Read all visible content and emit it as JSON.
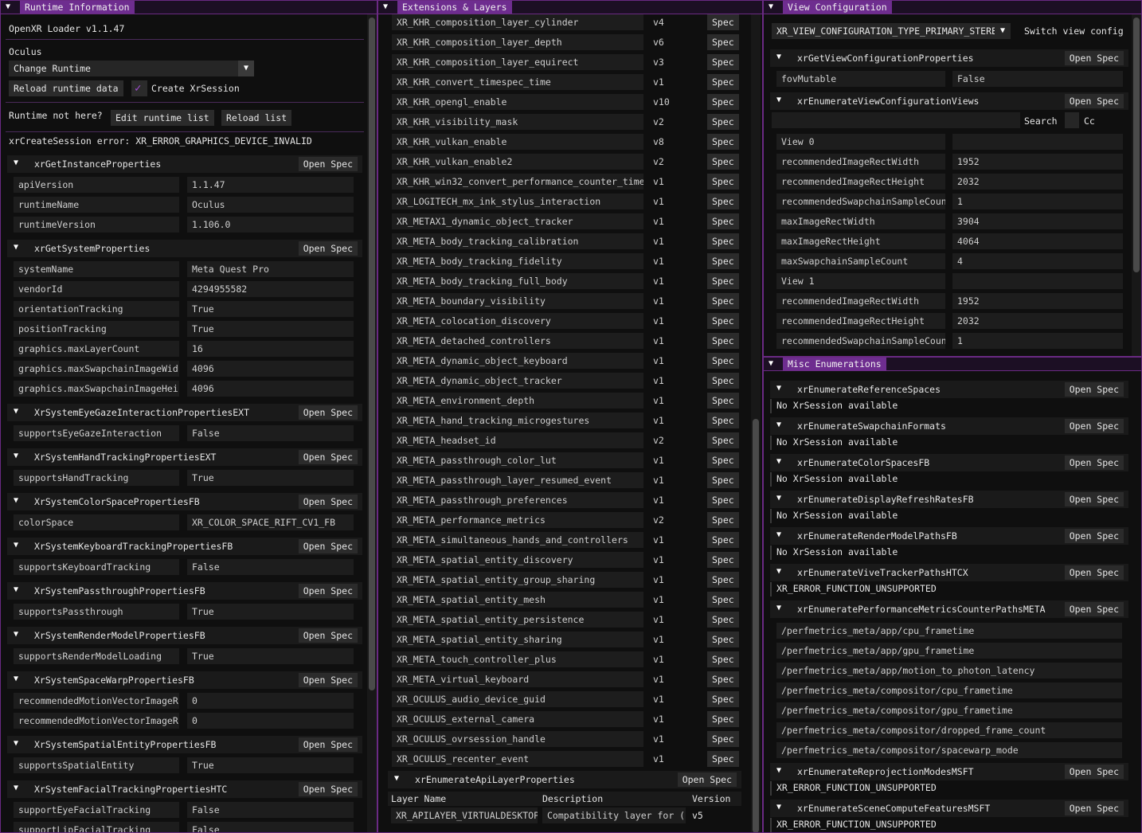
{
  "runtime": {
    "title": "Runtime Information",
    "loader": "OpenXR Loader v1.1.47",
    "runtime_name": "Oculus",
    "change_runtime": "Change Runtime",
    "reload_runtime": "Reload runtime data",
    "create_session": "Create XrSession",
    "not_here": "Runtime not here?",
    "edit_list": "Edit runtime list",
    "reload_list": "Reload list",
    "error": "xrCreateSession error: XR_ERROR_GRAPHICS_DEVICE_INVALID",
    "open_spec": "Open Spec",
    "sections": [
      {
        "name": "xrGetInstanceProperties",
        "rows": [
          [
            "apiVersion",
            "1.1.47"
          ],
          [
            "runtimeName",
            "Oculus"
          ],
          [
            "runtimeVersion",
            "1.106.0"
          ]
        ]
      },
      {
        "name": "xrGetSystemProperties",
        "rows": [
          [
            "systemName",
            "Meta Quest Pro"
          ],
          [
            "vendorId",
            "4294955582"
          ],
          [
            "orientationTracking",
            "True"
          ],
          [
            "positionTracking",
            "True"
          ],
          [
            "graphics.maxLayerCount",
            "16"
          ],
          [
            "graphics.maxSwapchainImageWid",
            "4096"
          ],
          [
            "graphics.maxSwapchainImageHei",
            "4096"
          ]
        ]
      },
      {
        "name": "XrSystemEyeGazeInteractionPropertiesEXT",
        "rows": [
          [
            "supportsEyeGazeInteraction",
            "False"
          ]
        ]
      },
      {
        "name": "XrSystemHandTrackingPropertiesEXT",
        "rows": [
          [
            "supportsHandTracking",
            "True"
          ]
        ]
      },
      {
        "name": "XrSystemColorSpacePropertiesFB",
        "rows": [
          [
            "colorSpace",
            "XR_COLOR_SPACE_RIFT_CV1_FB"
          ]
        ]
      },
      {
        "name": "XrSystemKeyboardTrackingPropertiesFB",
        "rows": [
          [
            "supportsKeyboardTracking",
            "False"
          ]
        ]
      },
      {
        "name": "XrSystemPassthroughPropertiesFB",
        "rows": [
          [
            "supportsPassthrough",
            "True"
          ]
        ]
      },
      {
        "name": "XrSystemRenderModelPropertiesFB",
        "rows": [
          [
            "supportsRenderModelLoading",
            "True"
          ]
        ]
      },
      {
        "name": "XrSystemSpaceWarpPropertiesFB",
        "rows": [
          [
            "recommendedMotionVectorImageR",
            "0"
          ],
          [
            "recommendedMotionVectorImageR",
            "0"
          ]
        ]
      },
      {
        "name": "XrSystemSpatialEntityPropertiesFB",
        "rows": [
          [
            "supportsSpatialEntity",
            "True"
          ]
        ]
      },
      {
        "name": "XrSystemFacialTrackingPropertiesHTC",
        "rows": [
          [
            "supportEyeFacialTracking",
            "False"
          ],
          [
            "supportLipFacialTracking",
            "False"
          ]
        ]
      }
    ]
  },
  "extensions": {
    "title": "Extensions & Layers",
    "spec": "Spec",
    "items": [
      [
        "XR_KHR_composition_layer_cylinder",
        "v4"
      ],
      [
        "XR_KHR_composition_layer_depth",
        "v6"
      ],
      [
        "XR_KHR_composition_layer_equirect",
        "v3"
      ],
      [
        "XR_KHR_convert_timespec_time",
        "v1"
      ],
      [
        "XR_KHR_opengl_enable",
        "v10"
      ],
      [
        "XR_KHR_visibility_mask",
        "v2"
      ],
      [
        "XR_KHR_vulkan_enable",
        "v8"
      ],
      [
        "XR_KHR_vulkan_enable2",
        "v2"
      ],
      [
        "XR_KHR_win32_convert_performance_counter_time",
        "v1"
      ],
      [
        "XR_LOGITECH_mx_ink_stylus_interaction",
        "v1"
      ],
      [
        "XR_METAX1_dynamic_object_tracker",
        "v1"
      ],
      [
        "XR_META_body_tracking_calibration",
        "v1"
      ],
      [
        "XR_META_body_tracking_fidelity",
        "v1"
      ],
      [
        "XR_META_body_tracking_full_body",
        "v1"
      ],
      [
        "XR_META_boundary_visibility",
        "v1"
      ],
      [
        "XR_META_colocation_discovery",
        "v1"
      ],
      [
        "XR_META_detached_controllers",
        "v1"
      ],
      [
        "XR_META_dynamic_object_keyboard",
        "v1"
      ],
      [
        "XR_META_dynamic_object_tracker",
        "v1"
      ],
      [
        "XR_META_environment_depth",
        "v1"
      ],
      [
        "XR_META_hand_tracking_microgestures",
        "v1"
      ],
      [
        "XR_META_headset_id",
        "v2"
      ],
      [
        "XR_META_passthrough_color_lut",
        "v1"
      ],
      [
        "XR_META_passthrough_layer_resumed_event",
        "v1"
      ],
      [
        "XR_META_passthrough_preferences",
        "v1"
      ],
      [
        "XR_META_performance_metrics",
        "v2"
      ],
      [
        "XR_META_simultaneous_hands_and_controllers",
        "v1"
      ],
      [
        "XR_META_spatial_entity_discovery",
        "v1"
      ],
      [
        "XR_META_spatial_entity_group_sharing",
        "v1"
      ],
      [
        "XR_META_spatial_entity_mesh",
        "v1"
      ],
      [
        "XR_META_spatial_entity_persistence",
        "v1"
      ],
      [
        "XR_META_spatial_entity_sharing",
        "v1"
      ],
      [
        "XR_META_touch_controller_plus",
        "v1"
      ],
      [
        "XR_META_virtual_keyboard",
        "v1"
      ],
      [
        "XR_OCULUS_audio_device_guid",
        "v1"
      ],
      [
        "XR_OCULUS_external_camera",
        "v1"
      ],
      [
        "XR_OCULUS_ovrsession_handle",
        "v1"
      ],
      [
        "XR_OCULUS_recenter_event",
        "v1"
      ]
    ],
    "api_layers_header": "xrEnumerateApiLayerProperties",
    "open_spec": "Open Spec",
    "layer_columns": [
      "Layer Name",
      "Description",
      "Version"
    ],
    "layers": [
      [
        "XR_APILAYER_VIRTUALDESKTOP",
        "Compatibility layer for (",
        "v5"
      ]
    ]
  },
  "view": {
    "title": "View Configuration",
    "combo": "XR_VIEW_CONFIGURATION_TYPE_PRIMARY_STEREO",
    "switch": "Switch view config",
    "open_spec": "Open Spec",
    "props_header": "xrGetViewConfigurationProperties",
    "fov": [
      "fovMutable",
      "False"
    ],
    "views_header": "xrEnumerateViewConfigurationViews",
    "search": "Search",
    "cc": "Cc",
    "rows": [
      [
        "View 0",
        ""
      ],
      [
        "recommendedImageRectWidth",
        "1952"
      ],
      [
        "recommendedImageRectHeight",
        "2032"
      ],
      [
        "recommendedSwapchainSampleCount",
        "1"
      ],
      [
        "maxImageRectWidth",
        "3904"
      ],
      [
        "maxImageRectHeight",
        "4064"
      ],
      [
        "maxSwapchainSampleCount",
        "4"
      ],
      [
        "View 1",
        ""
      ],
      [
        "recommendedImageRectWidth",
        "1952"
      ],
      [
        "recommendedImageRectHeight",
        "2032"
      ],
      [
        "recommendedSwapchainSampleCount",
        "1"
      ]
    ]
  },
  "misc": {
    "title": "Misc Enumerations",
    "open_spec": "Open Spec",
    "sections": [
      {
        "name": "xrEnumerateReferenceSpaces",
        "text": "No XrSession available"
      },
      {
        "name": "xrEnumerateSwapchainFormats",
        "text": "No XrSession available"
      },
      {
        "name": "xrEnumerateColorSpacesFB",
        "text": "No XrSession available"
      },
      {
        "name": "xrEnumerateDisplayRefreshRatesFB",
        "text": "No XrSession available"
      },
      {
        "name": "xrEnumerateRenderModelPathsFB",
        "text": "No XrSession available"
      },
      {
        "name": "xrEnumerateViveTrackerPathsHTCX",
        "text": "XR_ERROR_FUNCTION_UNSUPPORTED"
      },
      {
        "name": "xrEnumeratePerformanceMetricsCounterPathsMETA",
        "paths": [
          "/perfmetrics_meta/app/cpu_frametime",
          "/perfmetrics_meta/app/gpu_frametime",
          "/perfmetrics_meta/app/motion_to_photon_latency",
          "/perfmetrics_meta/compositor/cpu_frametime",
          "/perfmetrics_meta/compositor/gpu_frametime",
          "/perfmetrics_meta/compositor/dropped_frame_count",
          "/perfmetrics_meta/compositor/spacewarp_mode"
        ]
      },
      {
        "name": "xrEnumerateReprojectionModesMSFT",
        "text": "XR_ERROR_FUNCTION_UNSUPPORTED"
      },
      {
        "name": "xrEnumerateSceneComputeFeaturesMSFT",
        "text": "XR_ERROR_FUNCTION_UNSUPPORTED"
      }
    ]
  }
}
